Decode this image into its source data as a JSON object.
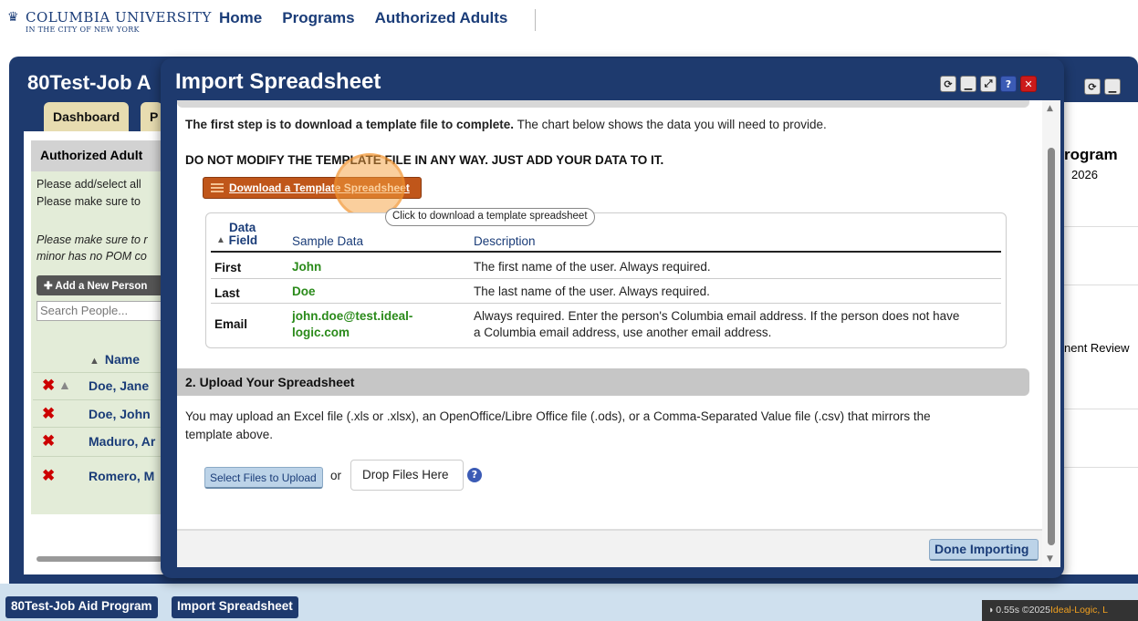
{
  "header": {
    "logo_name": "COLUMBIA UNIVERSITY",
    "logo_sub": "IN THE CITY OF NEW YORK",
    "nav": [
      "Home",
      "Programs",
      "Authorized Adults"
    ]
  },
  "background": {
    "app_title": "80Test-Job A",
    "tabs": [
      "Dashboard",
      "P"
    ],
    "panel_title": "Authorized Adult",
    "text_lines": [
      "Please add/select all",
      "Please make sure to"
    ],
    "italic_lines": [
      "Please make sure to r",
      "minor has no POM co"
    ],
    "add_button": "Add a New Person",
    "search_placeholder": "Search People...",
    "name_header": "Name",
    "people": [
      "Doe, Jane",
      "Doe, John",
      "Maduro, Ar",
      "Romero, M"
    ],
    "right_title": "rogram",
    "right_year": "2026",
    "right_review": "nent Review"
  },
  "modal": {
    "title": "Import Spreadsheet",
    "intro_bold": "The first step is to download a template file to complete.",
    "intro_rest": " The chart below shows the data you will need to provide.",
    "warning": "DO NOT MODIFY THE TEMPLATE FILE IN ANY WAY. JUST ADD YOUR DATA TO IT.",
    "download_button": "Download a Template Spreadsheet",
    "tooltip": "Click to download a template spreadsheet",
    "table": {
      "headers": {
        "field_1": "Data",
        "field_2": "Field",
        "sample": "Sample Data",
        "description": "Description"
      },
      "rows": [
        {
          "field": "First",
          "sample": "John",
          "description": "The first name of the user. Always required."
        },
        {
          "field": "Last",
          "sample": "Doe",
          "description": "The last name of the user. Always required."
        },
        {
          "field": "Email",
          "sample_1": "john.doe@test.ideal-",
          "sample_2": "logic.com",
          "description_1": "Always required. Enter the person's Columbia email address. If the person does not have",
          "description_2": "a Columbia email address, use another email address."
        }
      ]
    },
    "section2_title": "2. Upload Your Spreadsheet",
    "upload_text_1": "You may upload an Excel file (.xls or .xlsx), an OpenOffice/Libre Office file (.ods), or a Comma-Separated Value file (.csv) that mirrors the",
    "upload_text_2": "template above.",
    "select_button": "Select Files to Upload",
    "or_text": "or",
    "drop_zone": "Drop Files Here",
    "done_button": "Done Importing"
  },
  "taskbar": {
    "tabs": [
      "80Test-Job Aid Program",
      "Import Spreadsheet"
    ]
  },
  "footer": {
    "timing": "0.55s",
    "copyright": "©2025",
    "brand": "Ideal-Logic, L"
  }
}
